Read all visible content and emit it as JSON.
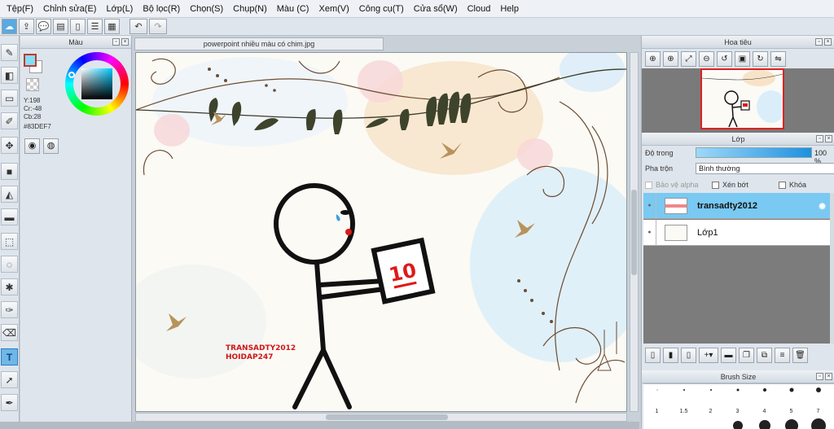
{
  "menu": [
    "Tệp(F)",
    "Chỉnh sửa(E)",
    "Lớp(L)",
    "Bộ lọc(R)",
    "Chọn(S)",
    "Chụp(N)",
    "Màu (C)",
    "Xem(V)",
    "Công cụ(T)",
    "Cửa sổ(W)",
    "Cloud",
    "Help"
  ],
  "color_panel": {
    "title": "Màu",
    "y": "Y:198",
    "cr": "Cr:-48",
    "cb": "Cb:28",
    "hex": "#83DEF7"
  },
  "document_tab": "powerpoint nhiều màu có chim.jpg",
  "canvas": {
    "text_line1": "TRANSADTY2012",
    "text_line2": "HOIDAP247",
    "sign_number": "10"
  },
  "navigator": {
    "title": "Hoa tiêu"
  },
  "layers": {
    "title": "Lớp",
    "opacity_label": "Độ trong",
    "opacity_value": "100 %",
    "blend_label": "Pha trộn",
    "blend_value": "Bình thường",
    "protect_alpha": "Bảo vệ alpha",
    "clipping": "Xén bớt",
    "lock": "Khóa",
    "items": [
      {
        "name": "transadty2012"
      },
      {
        "name": "Lớp1"
      }
    ]
  },
  "brush_size": {
    "title": "Brush Size",
    "labels": [
      "1",
      "1.5",
      "2",
      "3",
      "4",
      "5",
      "7"
    ]
  },
  "colors": {
    "accent": "#83DEF7",
    "selected_layer": "#79c9f2",
    "sign_red": "#e01818"
  }
}
